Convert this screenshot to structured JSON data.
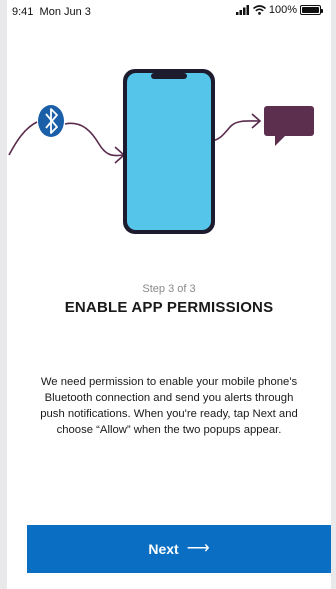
{
  "status_bar": {
    "time": "9:41",
    "date": "Mon Jun 3",
    "battery": "100%"
  },
  "illustration": {
    "icons": [
      "bluetooth-icon",
      "phone-icon",
      "message-bubble-icon"
    ],
    "colors": {
      "phone_screen": "#55c6ea",
      "phone_frame": "#1c1c2e",
      "bluetooth": "#1a5fa8",
      "message": "#5c2f4e",
      "connector": "#5a2b4d"
    }
  },
  "onboarding": {
    "step": "Step 3 of 3",
    "title": "ENABLE APP PERMISSIONS",
    "body_lines": [
      "We need permission to enable your mobile phone's",
      "Bluetooth connection and send you alerts through",
      "push notifications. When you're ready, tap Next and",
      "choose “Allow” when the two popups appear."
    ]
  },
  "next_button": {
    "label": "Next",
    "color": "#0a6ec2"
  }
}
